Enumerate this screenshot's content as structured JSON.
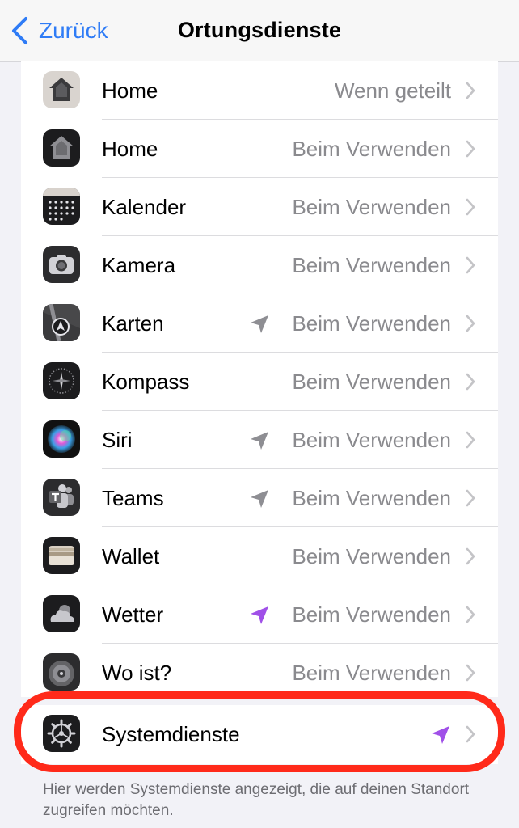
{
  "navbar": {
    "back_label": "Zurück",
    "title": "Ortungsdienste"
  },
  "apps": [
    {
      "name": "Home",
      "value": "Wenn geteilt",
      "icon": "home-icon",
      "location_arrow": null
    },
    {
      "name": "Home",
      "value": "Beim Verwenden",
      "icon": "home-dark-icon",
      "location_arrow": null
    },
    {
      "name": "Kalender",
      "value": "Beim Verwenden",
      "icon": "calendar-icon",
      "location_arrow": null
    },
    {
      "name": "Kamera",
      "value": "Beim Verwenden",
      "icon": "camera-icon",
      "location_arrow": null
    },
    {
      "name": "Karten",
      "value": "Beim Verwenden",
      "icon": "maps-icon",
      "location_arrow": "gray"
    },
    {
      "name": "Kompass",
      "value": "Beim Verwenden",
      "icon": "compass-icon",
      "location_arrow": null
    },
    {
      "name": "Siri",
      "value": "Beim Verwenden",
      "icon": "siri-icon",
      "location_arrow": "gray"
    },
    {
      "name": "Teams",
      "value": "Beim Verwenden",
      "icon": "teams-icon",
      "location_arrow": "gray"
    },
    {
      "name": "Wallet",
      "value": "Beim Verwenden",
      "icon": "wallet-icon",
      "location_arrow": null
    },
    {
      "name": "Wetter",
      "value": "Beim Verwenden",
      "icon": "weather-icon",
      "location_arrow": "purple"
    },
    {
      "name": "Wo ist?",
      "value": "Beim Verwenden",
      "icon": "find-my-icon",
      "location_arrow": null
    }
  ],
  "system_services": {
    "label": "Systemdienste",
    "icon": "settings-gear-icon",
    "location_arrow": "purple"
  },
  "footer_note": "Hier werden Systemdienste angezeigt, die auf deinen Standort zugreifen möchten.",
  "colors": {
    "accent_blue": "#2f7cf6",
    "arrow_gray": "#8e8e93",
    "arrow_purple": "#a050e8",
    "highlight_red": "#ff2a1a"
  }
}
